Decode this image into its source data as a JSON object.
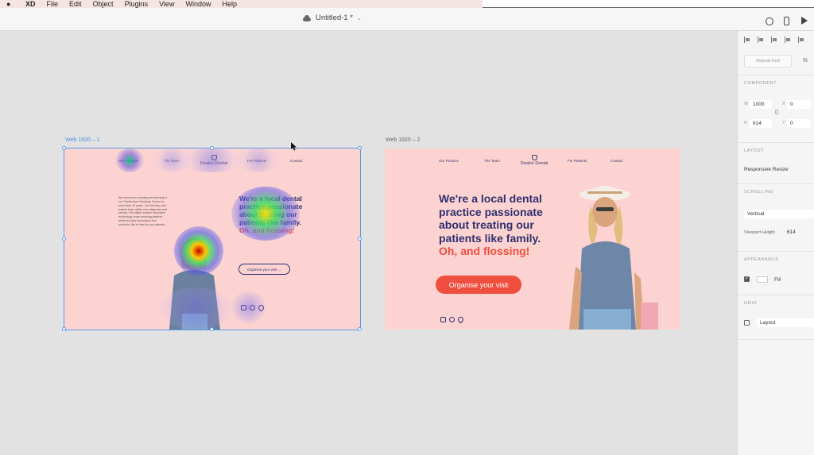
{
  "menubar": {
    "app": "XD",
    "items": [
      "File",
      "Edit",
      "Object",
      "Plugins",
      "View",
      "Window",
      "Help"
    ]
  },
  "titlebar": {
    "doc_title": "Untitled-1 *"
  },
  "artboards": [
    {
      "label": "Web 1920 – 1",
      "nav": [
        "Our Practice",
        "The Team",
        "For Patients",
        "Contact"
      ],
      "logo": "Deakin Dental",
      "body_text": "We have been working and learning in our Cheltenham Dentistry Centre for more than 10 years. Our friendly, well-trained team utilise new diagnosis and service. We utilise modern innovative technology, learn amazing patients preferred plus techniques and products. We're here for our patients.",
      "headline": "We're a local dental practice passionate about treating our patients like family.",
      "headline_accent": "Oh, and flossing!",
      "cta": "Organise your visit"
    },
    {
      "label": "Web 1920 – 2",
      "nav": [
        "Our Practice",
        "The Team",
        "For Patients",
        "Contact"
      ],
      "logo": "Deakin Dental",
      "headline_lines": [
        "We're a local dental",
        "practice passionate",
        "about treating our",
        "patients like family."
      ],
      "headline_accent": "Oh, and flossing!",
      "cta": "Organise your visit"
    }
  ],
  "panel": {
    "repeat_grid": "Repeat Grid",
    "component": "COMPONENT",
    "w_label": "W",
    "w_value": "1000",
    "x_label": "X",
    "x_value": "0",
    "h_label": "H",
    "h_value": "614",
    "y_label": "Y",
    "y_value": "0",
    "layout_heading": "LAYOUT",
    "responsive": "Responsive Resize",
    "scrolling_heading": "SCROLLING",
    "scroll_value": "Vertical",
    "viewport_label": "Viewport Height",
    "viewport_value": "614",
    "appearance_heading": "APPEARANCE",
    "fill_label": "Fill",
    "grid_heading": "GRID",
    "grid_value": "Layout"
  },
  "colors": {
    "artboard_bg": "#fdd3d2",
    "brand_navy": "#2e2f6e",
    "brand_accent": "#f04e3e",
    "selection": "#5a9de6"
  }
}
